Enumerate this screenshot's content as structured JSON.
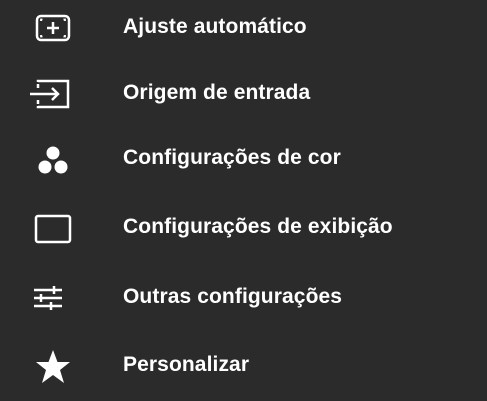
{
  "menu": {
    "items": [
      {
        "label": "Ajuste automático",
        "icon": "auto-adjust-icon"
      },
      {
        "label": "Origem de entrada",
        "icon": "input-source-icon"
      },
      {
        "label": "Configurações de cor",
        "icon": "color-dots-icon"
      },
      {
        "label": "Configurações de exibição",
        "icon": "display-rectangle-icon"
      },
      {
        "label": "Outras configurações",
        "icon": "sliders-icon"
      },
      {
        "label": "Personalizar",
        "icon": "star-icon"
      }
    ]
  },
  "colors": {
    "background": "#2b2b2b",
    "foreground": "#ffffff"
  }
}
